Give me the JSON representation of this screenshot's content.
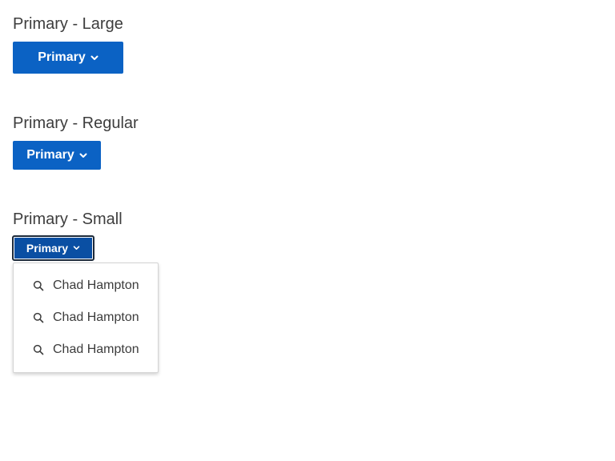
{
  "sections": [
    {
      "title": "Primary - Large",
      "button_label": "Primary"
    },
    {
      "title": "Primary - Regular",
      "button_label": "Primary"
    },
    {
      "title": "Primary - Small",
      "button_label": "Primary"
    }
  ],
  "dropdown": {
    "items": [
      {
        "label": "Chad Hampton",
        "icon": "search-icon"
      },
      {
        "label": "Chad Hampton",
        "icon": "search-icon"
      },
      {
        "label": "Chad Hampton",
        "icon": "search-icon"
      }
    ]
  },
  "colors": {
    "primary": "#0b62c4",
    "primary_active": "#0a4fa3",
    "text": "#3c3c3c"
  }
}
